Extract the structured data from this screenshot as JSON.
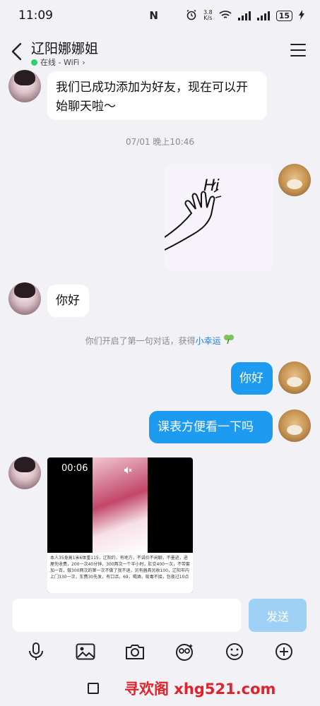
{
  "status": {
    "time": "11:09",
    "nfc": "N",
    "speed_value": "3.8",
    "speed_unit": "K/s",
    "battery": "15"
  },
  "header": {
    "title": "辽阳娜娜姐",
    "status": "在线 - WiFi",
    "status_color": "#2ad46a"
  },
  "messages": {
    "m1": "我们已成功添加为好友，现在可以开始聊天啦～",
    "timestamp": "07/01 晚上10:46",
    "m2": "你好",
    "system_prefix": "你们开启了第一句对话，获得",
    "system_link": "小幸运",
    "m3": "你好",
    "m4": "课表方便看一下吗",
    "video_time": "00:06",
    "video_desc": "本人35身高1米6体重115，辽阳约，有地方，不讲价不闲聊，不墨迹，进屋先收费，200一次40分钟，300两次一个半小时，肛交400一次，不带套加一百，做300两次的第一次不做了我不退，另有器具另收100，辽阳市内上门330一次，车费30先发，有口活，69，喝酒，吸毒不接，包夜过10点"
  },
  "input": {
    "send_label": "发送",
    "placeholder": ""
  },
  "watermark": "寻欢阁 xhg521.com",
  "colors": {
    "accent": "#1d9bf0",
    "send_disabled": "#9fd0f5",
    "background": "#f2f1f6"
  }
}
